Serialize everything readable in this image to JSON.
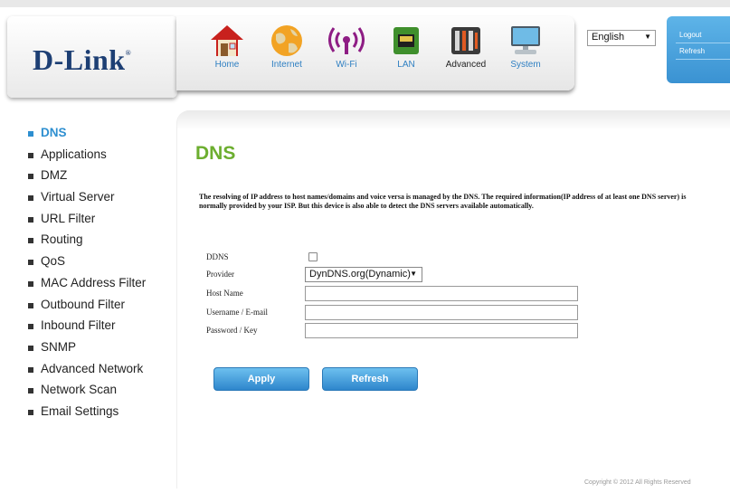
{
  "brand": {
    "logo": "D-Link",
    "reg": "®"
  },
  "nav": [
    {
      "label": "Home",
      "icon": "home-icon",
      "active": false
    },
    {
      "label": "Internet",
      "icon": "globe-icon",
      "active": false
    },
    {
      "label": "Wi-Fi",
      "icon": "wifi-icon",
      "active": false
    },
    {
      "label": "LAN",
      "icon": "lan-icon",
      "active": false
    },
    {
      "label": "Advanced",
      "icon": "tools-icon",
      "active": true
    },
    {
      "label": "System",
      "icon": "computer-icon",
      "active": false
    }
  ],
  "language": {
    "selected": "English"
  },
  "util": {
    "logout": "Logout",
    "refresh": "Refresh"
  },
  "sidebar": [
    {
      "label": "DNS",
      "active": true
    },
    {
      "label": "Applications"
    },
    {
      "label": "DMZ"
    },
    {
      "label": "Virtual Server"
    },
    {
      "label": "URL Filter"
    },
    {
      "label": "Routing"
    },
    {
      "label": "QoS"
    },
    {
      "label": "MAC Address Filter"
    },
    {
      "label": "Outbound Filter"
    },
    {
      "label": "Inbound Filter"
    },
    {
      "label": "SNMP"
    },
    {
      "label": "Advanced Network"
    },
    {
      "label": "Network Scan"
    },
    {
      "label": "Email Settings"
    }
  ],
  "page": {
    "title": "DNS",
    "description": "The resolving of IP address to host names/domains and voice versa is managed by the DNS. The required information(IP address of at least one DNS server) is normally provided by your ISP. But this device is also able to detect the DNS servers available automatically."
  },
  "form": {
    "ddns_label": "DDNS",
    "ddns_checked": false,
    "provider_label": "Provider",
    "provider_value": "DynDNS.org(Dynamic)",
    "hostname_label": "Host Name",
    "hostname_value": "",
    "username_label": "Username / E-mail",
    "username_value": "",
    "password_label": "Password / Key",
    "password_value": ""
  },
  "buttons": {
    "apply": "Apply",
    "refresh": "Refresh"
  },
  "footer": {
    "copyright": "Copyright © 2012 All Rights Reserved"
  },
  "colors": {
    "accent_blue": "#2e8fd0",
    "title_green": "#6cae2f",
    "brand_navy": "#1d3f74"
  }
}
